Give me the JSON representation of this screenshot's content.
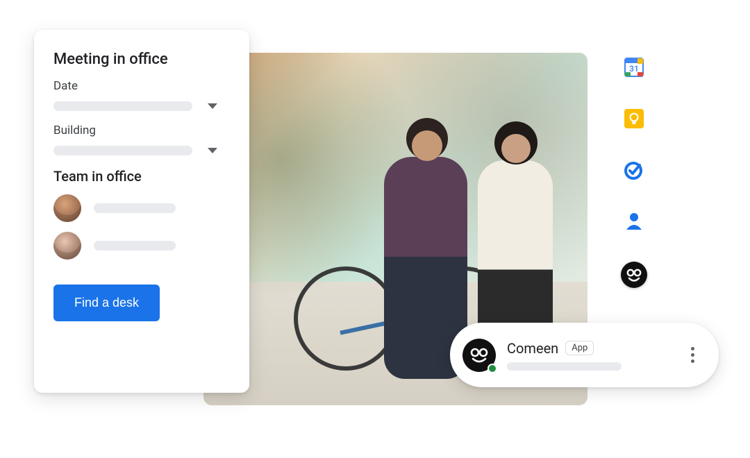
{
  "booking_card": {
    "title": "Meeting in office",
    "date_label": "Date",
    "building_label": "Building",
    "team_section_title": "Team in office",
    "cta_label": "Find a desk",
    "team_members": [
      "team-member-1",
      "team-member-2"
    ]
  },
  "app_pill": {
    "name": "Comeen",
    "badge": "App"
  },
  "app_rail": {
    "icons": [
      {
        "id": "google-calendar-icon",
        "badge_text": "31"
      },
      {
        "id": "google-keep-icon"
      },
      {
        "id": "google-tasks-icon"
      },
      {
        "id": "google-contacts-icon"
      },
      {
        "id": "comeen-icon"
      }
    ]
  },
  "colors": {
    "primary": "#1a73e8",
    "text": "#202124",
    "muted": "#5f6368",
    "placeholder": "#e8eaed",
    "presence_online": "#1e8e3e"
  }
}
